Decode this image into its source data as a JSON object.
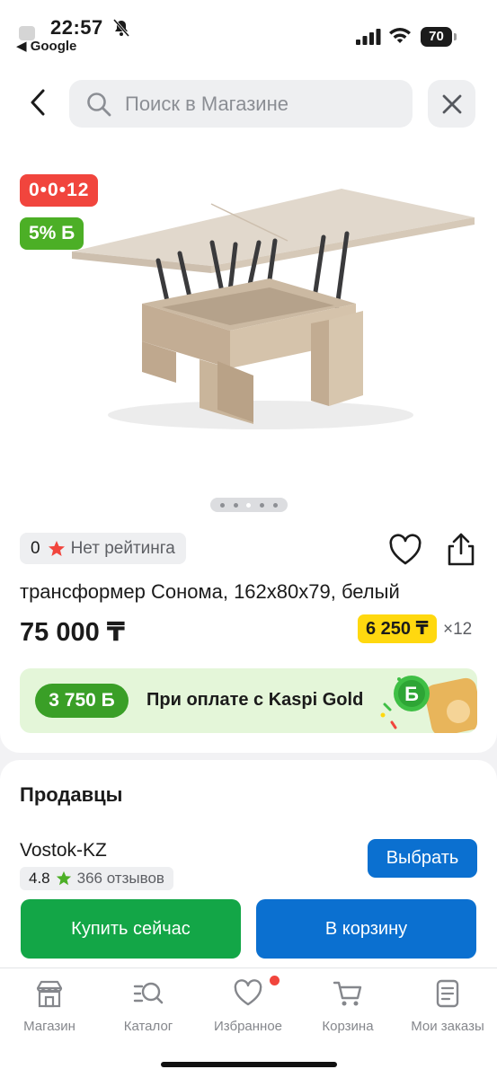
{
  "status_bar": {
    "time": "22:57",
    "back_app": "◀ Google",
    "battery": "70",
    "icons": [
      "bell-slash-icon",
      "signal-icon",
      "wifi-icon",
      "battery-icon"
    ]
  },
  "search": {
    "placeholder": "Поиск в Магазине",
    "icons": [
      "back-arrow-icon",
      "search-icon",
      "close-icon"
    ]
  },
  "product": {
    "sale_badge": "0•0•12",
    "bonus_badge": "5% Б",
    "gallery_pages": 5,
    "gallery_active_index": 2,
    "rating_value": "0",
    "rating_text": "Нет рейтинга",
    "title": "трансформер Сонома, 162x80x79, белый",
    "price": "75 000 ₸",
    "installment_price": "6 250 ₸",
    "installment_months": "×12",
    "gold_bonus": "3 750 Б",
    "gold_text": "При оплате с Kaspi Gold"
  },
  "sellers": {
    "heading": "Продавцы",
    "items": [
      {
        "name": "Vostok-KZ",
        "rating": "4.8",
        "reviews": "366 отзывов",
        "choose_label": "Выбрать"
      }
    ],
    "buy_now_label": "Купить сейчас",
    "add_to_cart_label": "В корзину"
  },
  "bottom_nav": {
    "items": [
      {
        "label": "Магазин",
        "icon": "store-icon"
      },
      {
        "label": "Каталог",
        "icon": "catalog-search-icon"
      },
      {
        "label": "Избранное",
        "icon": "heart-icon",
        "has_notification": true
      },
      {
        "label": "Корзина",
        "icon": "cart-icon"
      },
      {
        "label": "Мои заказы",
        "icon": "orders-icon"
      }
    ]
  },
  "colors": {
    "sale_red": "#f1453d",
    "bonus_green": "#4caf26",
    "installment_yellow": "#ffd80f",
    "buy_green": "#13a647",
    "primary_blue": "#0b70d0",
    "gold_banner_bg": "#e4f6d9"
  }
}
